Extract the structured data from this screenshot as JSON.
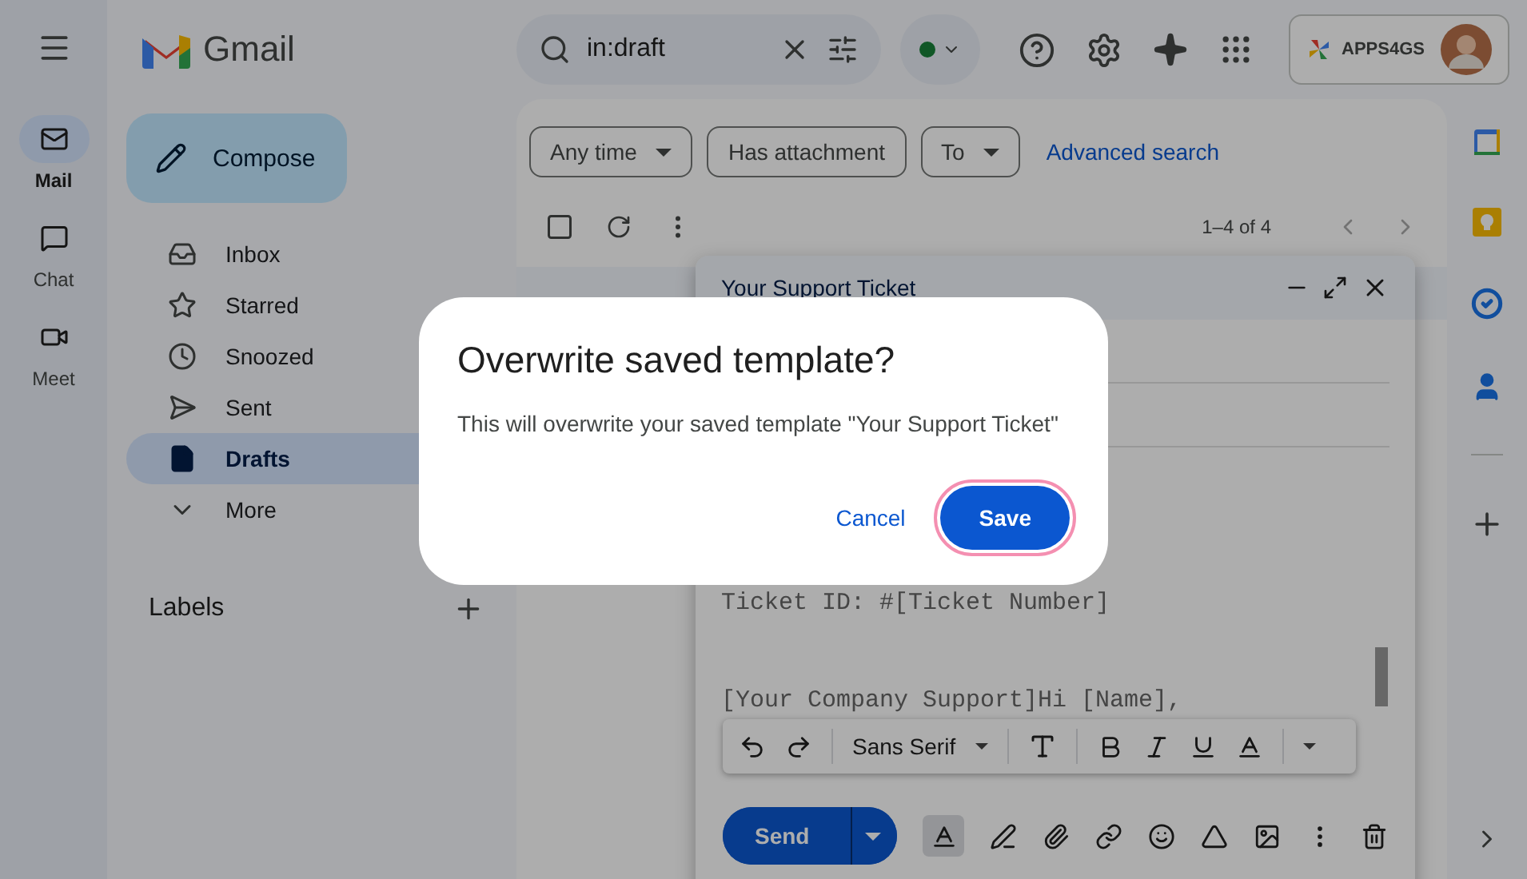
{
  "header": {
    "app_name": "Gmail",
    "search": {
      "value": "in:draft"
    },
    "account": {
      "label": "APPS4GS"
    }
  },
  "rail": [
    {
      "label": "Mail",
      "selected": true
    },
    {
      "label": "Chat",
      "selected": false
    },
    {
      "label": "Meet",
      "selected": false
    }
  ],
  "compose_label": "Compose",
  "nav": [
    {
      "label": "Inbox",
      "selected": false
    },
    {
      "label": "Starred",
      "selected": false
    },
    {
      "label": "Snoozed",
      "selected": false
    },
    {
      "label": "Sent",
      "selected": false
    },
    {
      "label": "Drafts",
      "selected": true
    },
    {
      "label": "More",
      "selected": false
    }
  ],
  "labels_heading": "Labels",
  "filters": [
    {
      "label": "Any time",
      "dropdown": true
    },
    {
      "label": "Has attachment",
      "dropdown": false
    },
    {
      "label": "To",
      "dropdown": true
    }
  ],
  "advanced_search": "Advanced search",
  "select_all": {
    "checked": false
  },
  "pagination": "1–4 of 4",
  "compose_window": {
    "title": "Your Support Ticket",
    "body_lines": [
      "Ticket ID: #[Ticket Number]",
      "[Your Company Support]Hi [Name],"
    ],
    "toolbar": {
      "font": "Sans Serif"
    },
    "send": "Send"
  },
  "dialog": {
    "title": "Overwrite saved template?",
    "message": "This will overwrite your saved template \"Your Support Ticket\"",
    "buttons": [
      {
        "label": "Cancel",
        "kind": "text",
        "highlighted": false
      },
      {
        "label": "Save",
        "kind": "filled",
        "highlighted": true
      }
    ]
  }
}
